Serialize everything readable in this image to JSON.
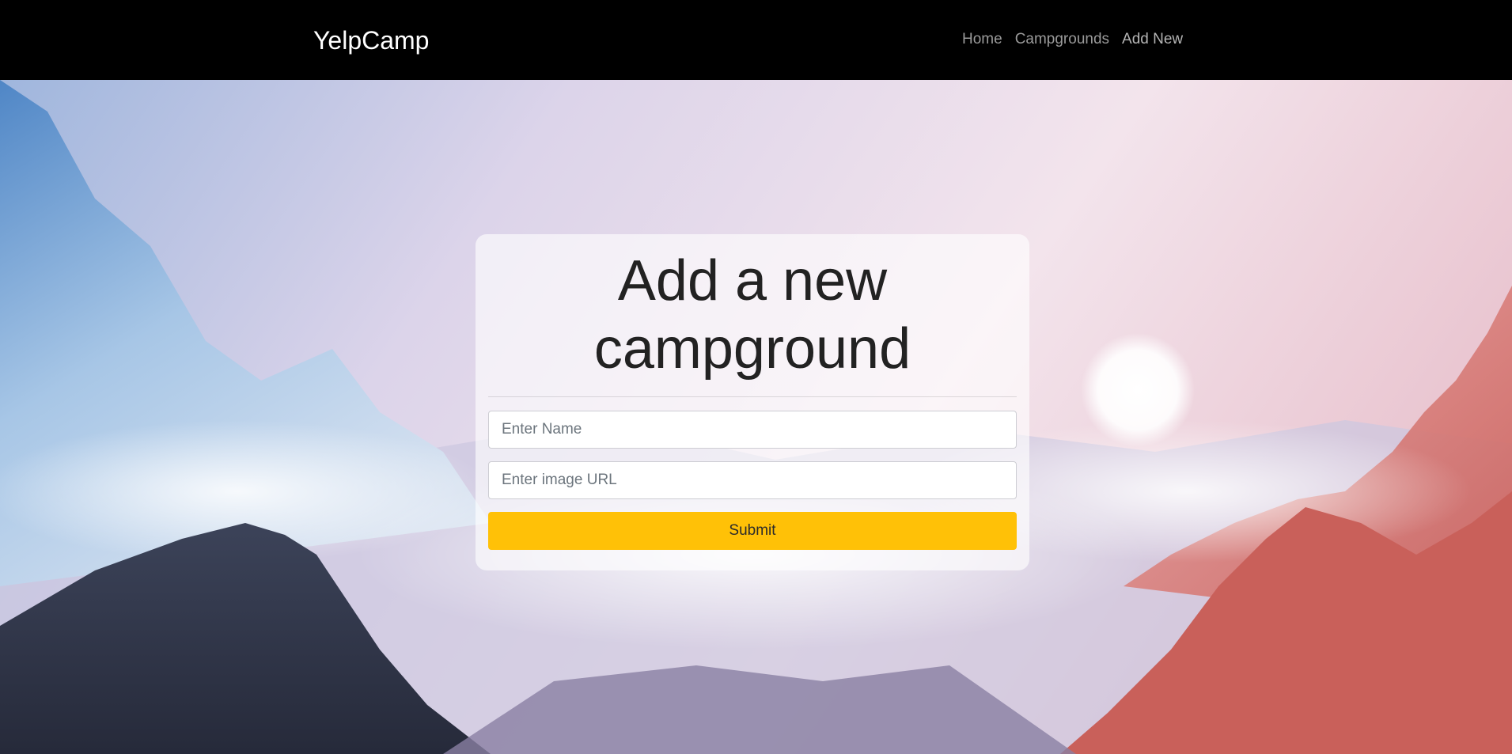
{
  "navbar": {
    "brand": "YelpCamp",
    "links": [
      {
        "label": "Home"
      },
      {
        "label": "Campgrounds"
      },
      {
        "label": "Add New"
      }
    ]
  },
  "form": {
    "title": "Add a new campground",
    "name_placeholder": "Enter Name",
    "image_placeholder": "Enter image URL",
    "submit_label": "Submit"
  },
  "colors": {
    "navbar_bg": "#000000",
    "submit_bg": "#ffc107",
    "link_color": "#9a9a9a"
  }
}
